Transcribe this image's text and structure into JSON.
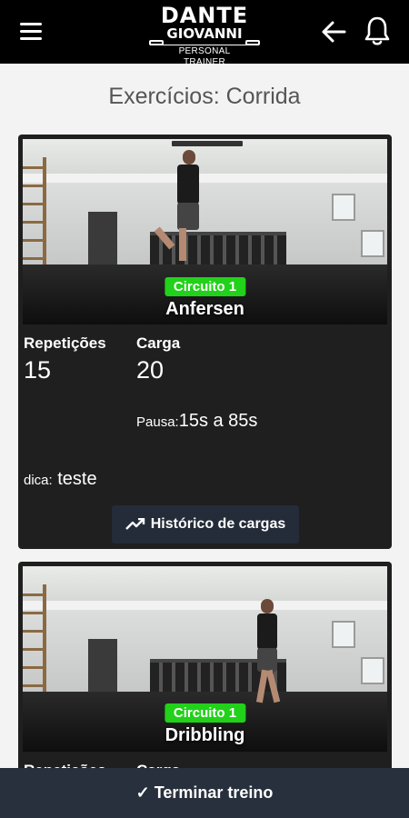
{
  "header": {
    "logo_line1": "DANTE",
    "logo_line2": "GIOVANNI",
    "logo_line3": "PERSONAL TRAINER",
    "icons": [
      "menu-icon",
      "back-arrow-icon",
      "bell-icon"
    ]
  },
  "page": {
    "title": "Exercícios: Corrida"
  },
  "exercises": [
    {
      "circuit": "Circuito 1",
      "name": "Anfersen",
      "reps_label": "Repetições",
      "reps_value": "15",
      "load_label": "Carga",
      "load_value": "20",
      "pause_label": "Pausa:",
      "pause_value": "15s a 85s",
      "tip_label": "dica:",
      "tip_value": "teste",
      "history_button": "Histórico de cargas"
    },
    {
      "circuit": "Circuito 1",
      "name": "Dribbling",
      "reps_label": "Repetições",
      "load_label": "Carga"
    }
  ],
  "footer": {
    "finish_label": "✓ Terminar treino"
  },
  "colors": {
    "topbar": "#000000",
    "card": "#1f1f1f",
    "badge": "#22d11a",
    "button": "#232c38",
    "footer": "#27303c",
    "background": "#f3f3f3"
  }
}
